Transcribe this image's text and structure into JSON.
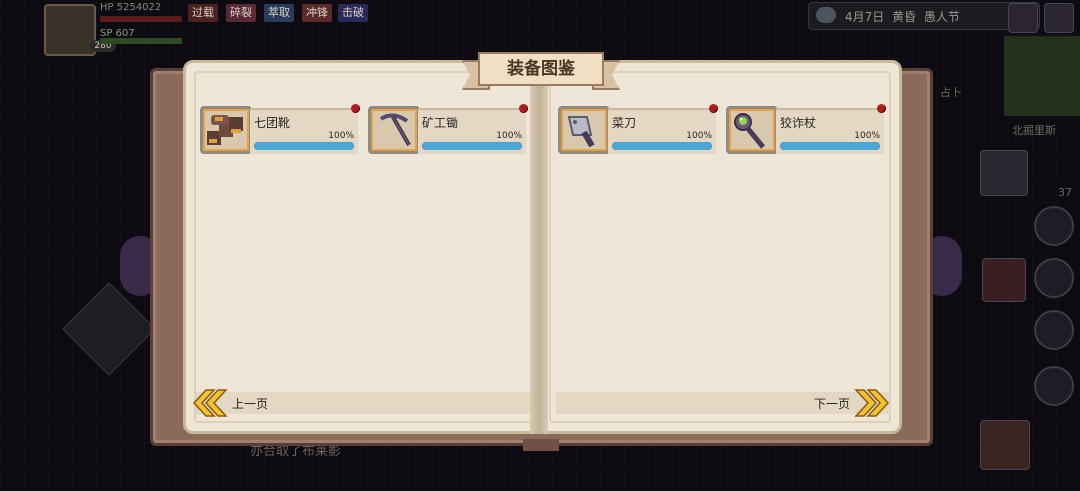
{
  "hud": {
    "hp_text": "HP 5254022",
    "sp_label": "SP",
    "sp_value": "607",
    "level": "280",
    "tags": [
      "过载",
      "碎裂",
      "萃取",
      "冲锋",
      "击破"
    ],
    "date": "4月7日  黄昏  愚人节",
    "side_label_1": "占卜",
    "side_label_2": "北掘里斯",
    "side_count": "37",
    "bottom_text": "亦合取了布莱影"
  },
  "book": {
    "title": "装备图鉴",
    "prev_label": "上一页",
    "next_label": "下一页",
    "items": [
      {
        "name": "七团靴",
        "percent_label": "100%",
        "progress": 1.0,
        "icon": "boots-icon"
      },
      {
        "name": "矿工锄",
        "percent_label": "100%",
        "progress": 1.0,
        "icon": "pickaxe-icon"
      },
      {
        "name": "菜刀",
        "percent_label": "100%",
        "progress": 1.0,
        "icon": "cleaver-icon"
      },
      {
        "name": "狡诈杖",
        "percent_label": "100%",
        "progress": 1.0,
        "icon": "staff-icon"
      }
    ]
  },
  "colors": {
    "progress_fill": "#4ba6d8",
    "new_dot": "#b01c1c",
    "icon_border_accent": "#e9a040",
    "chevron": "#f2c230"
  }
}
